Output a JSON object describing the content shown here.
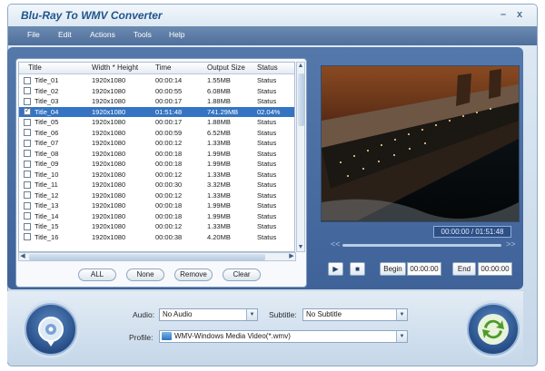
{
  "app": {
    "title": "Blu-Ray To WMV Converter",
    "minimize": "–",
    "close": "x"
  },
  "menu": [
    "File",
    "Edit",
    "Actions",
    "Tools",
    "Help"
  ],
  "list": {
    "columns": [
      "Title",
      "Width * Height",
      "Time",
      "Output Size",
      "Status"
    ],
    "rows": [
      {
        "title": "Title_01",
        "size": "1920x1080",
        "time": "00:00:14",
        "output": "1.55MB",
        "status": "Status",
        "checked": false,
        "selected": false
      },
      {
        "title": "Title_02",
        "size": "1920x1080",
        "time": "00:00:55",
        "output": "6.08MB",
        "status": "Status",
        "checked": false,
        "selected": false
      },
      {
        "title": "Title_03",
        "size": "1920x1080",
        "time": "00:00:17",
        "output": "1.88MB",
        "status": "Status",
        "checked": false,
        "selected": false
      },
      {
        "title": "Title_04",
        "size": "1920x1080",
        "time": "01:51:48",
        "output": "741.29MB",
        "status": "02.04%",
        "checked": true,
        "selected": true
      },
      {
        "title": "Title_05",
        "size": "1920x1080",
        "time": "00:00:17",
        "output": "1.88MB",
        "status": "Status",
        "checked": false,
        "selected": false
      },
      {
        "title": "Title_06",
        "size": "1920x1080",
        "time": "00:00:59",
        "output": "6.52MB",
        "status": "Status",
        "checked": false,
        "selected": false
      },
      {
        "title": "Title_07",
        "size": "1920x1080",
        "time": "00:00:12",
        "output": "1.33MB",
        "status": "Status",
        "checked": false,
        "selected": false
      },
      {
        "title": "Title_08",
        "size": "1920x1080",
        "time": "00:00:18",
        "output": "1.99MB",
        "status": "Status",
        "checked": false,
        "selected": false
      },
      {
        "title": "Title_09",
        "size": "1920x1080",
        "time": "00:00:18",
        "output": "1.99MB",
        "status": "Status",
        "checked": false,
        "selected": false
      },
      {
        "title": "Title_10",
        "size": "1920x1080",
        "time": "00:00:12",
        "output": "1.33MB",
        "status": "Status",
        "checked": false,
        "selected": false
      },
      {
        "title": "Title_11",
        "size": "1920x1080",
        "time": "00:00:30",
        "output": "3.32MB",
        "status": "Status",
        "checked": false,
        "selected": false
      },
      {
        "title": "Title_12",
        "size": "1920x1080",
        "time": "00:00:12",
        "output": "1.33MB",
        "status": "Status",
        "checked": false,
        "selected": false
      },
      {
        "title": "Title_13",
        "size": "1920x1080",
        "time": "00:00:18",
        "output": "1.99MB",
        "status": "Status",
        "checked": false,
        "selected": false
      },
      {
        "title": "Title_14",
        "size": "1920x1080",
        "time": "00:00:18",
        "output": "1.99MB",
        "status": "Status",
        "checked": false,
        "selected": false
      },
      {
        "title": "Title_15",
        "size": "1920x1080",
        "time": "00:00:12",
        "output": "1.33MB",
        "status": "Status",
        "checked": false,
        "selected": false
      },
      {
        "title": "Title_16",
        "size": "1920x1080",
        "time": "00:00:38",
        "output": "4.20MB",
        "status": "Status",
        "checked": false,
        "selected": false
      }
    ],
    "buttons": {
      "all": "ALL",
      "none": "None",
      "remove": "Remove",
      "clear": "Clear"
    }
  },
  "player": {
    "time": "00:00:00 / 01:51:48",
    "rewind": "<<",
    "forward": ">>",
    "begin_label": "Begin",
    "begin_value": "00:00:00",
    "end_label": "End",
    "end_value": "00:00:00"
  },
  "options": {
    "audio_label": "Audio:",
    "audio_value": "No Audio",
    "subtitle_label": "Subtitle:",
    "subtitle_value": "No Subtitle",
    "profile_label": "Profile:",
    "profile_value": "WMV-Windows Media Video(*.wmv)"
  },
  "colors": {
    "accent": "#3574c2",
    "panel": "#4a6ea3",
    "title_text": "#20558c"
  }
}
